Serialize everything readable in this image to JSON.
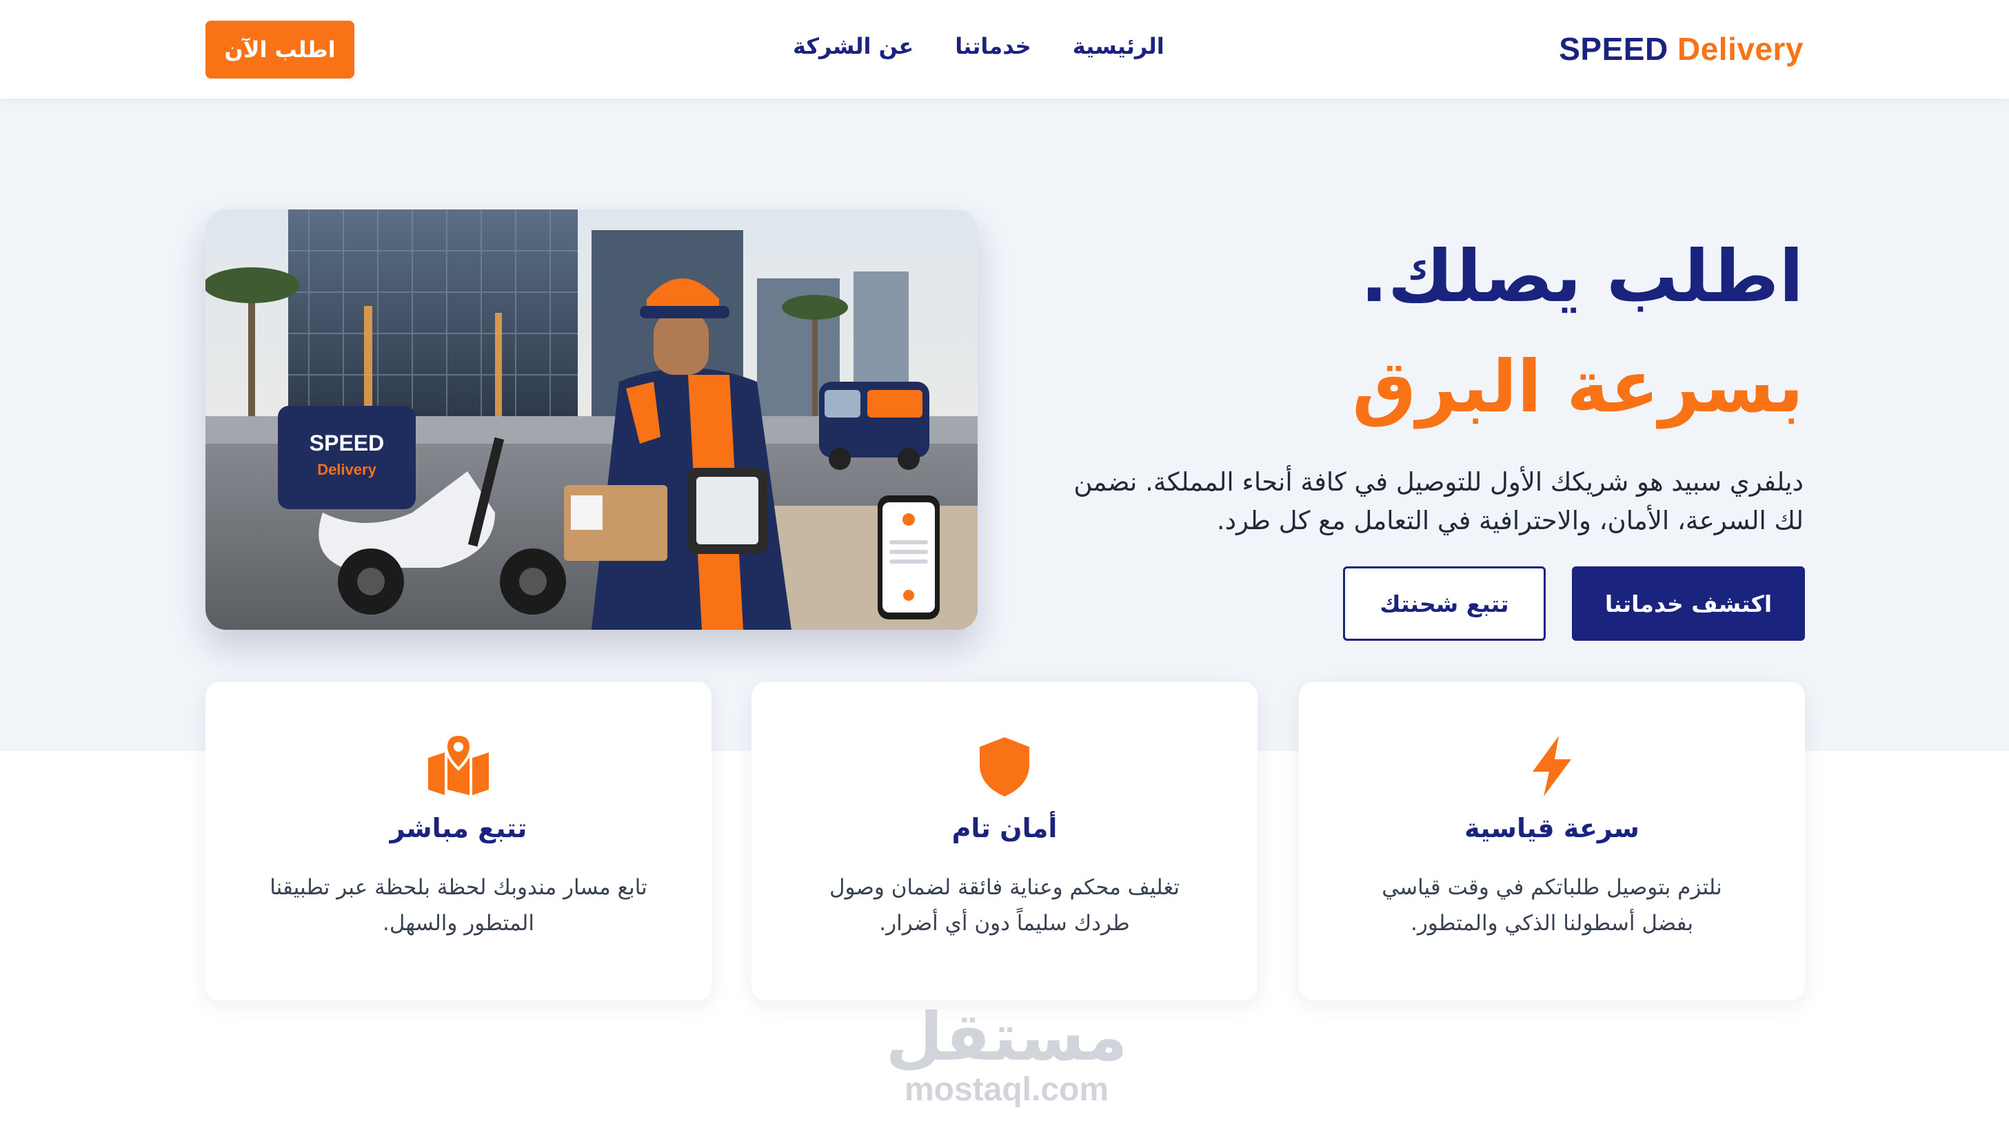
{
  "brand": {
    "name_part1": "SPEED",
    "name_part2": "Delivery",
    "navy": "#1a237e",
    "orange": "#f97316"
  },
  "nav": {
    "links": [
      "الرئيسية",
      "خدماتنا",
      "عن الشركة"
    ],
    "cta": "اطلب الآن"
  },
  "hero": {
    "title_line1": "اطلب يصلك.",
    "title_line2": "بسرعة البرق",
    "description": "ديلفري سبيد هو شريكك الأول للتوصيل في كافة أنحاء المملكة. نضمن لك السرعة، الأمان، والاحترافية في التعامل مع كل طرد.",
    "primary_button": "اكتشف خدماتنا",
    "secondary_button": "تتبع شحنتك",
    "image_icon": "courier-scooter-photo"
  },
  "features": [
    {
      "icon": "lightning-icon",
      "title": "سرعة قياسية",
      "description": "نلتزم بتوصيل طلباتكم في وقت قياسي بفضل أسطولنا الذكي والمتطور."
    },
    {
      "icon": "shield-icon",
      "title": "أمان تام",
      "description": "تغليف محكم وعناية فائقة لضمان وصول طردك سليماً دون أي أضرار."
    },
    {
      "icon": "map-pin-icon",
      "title": "تتبع مباشر",
      "description": "تابع مسار مندوبك لحظة بلحظة عبر تطبيقنا المتطور والسهل."
    }
  ],
  "watermark": {
    "arabic": "مستقل",
    "latin": "mostaql.com"
  }
}
